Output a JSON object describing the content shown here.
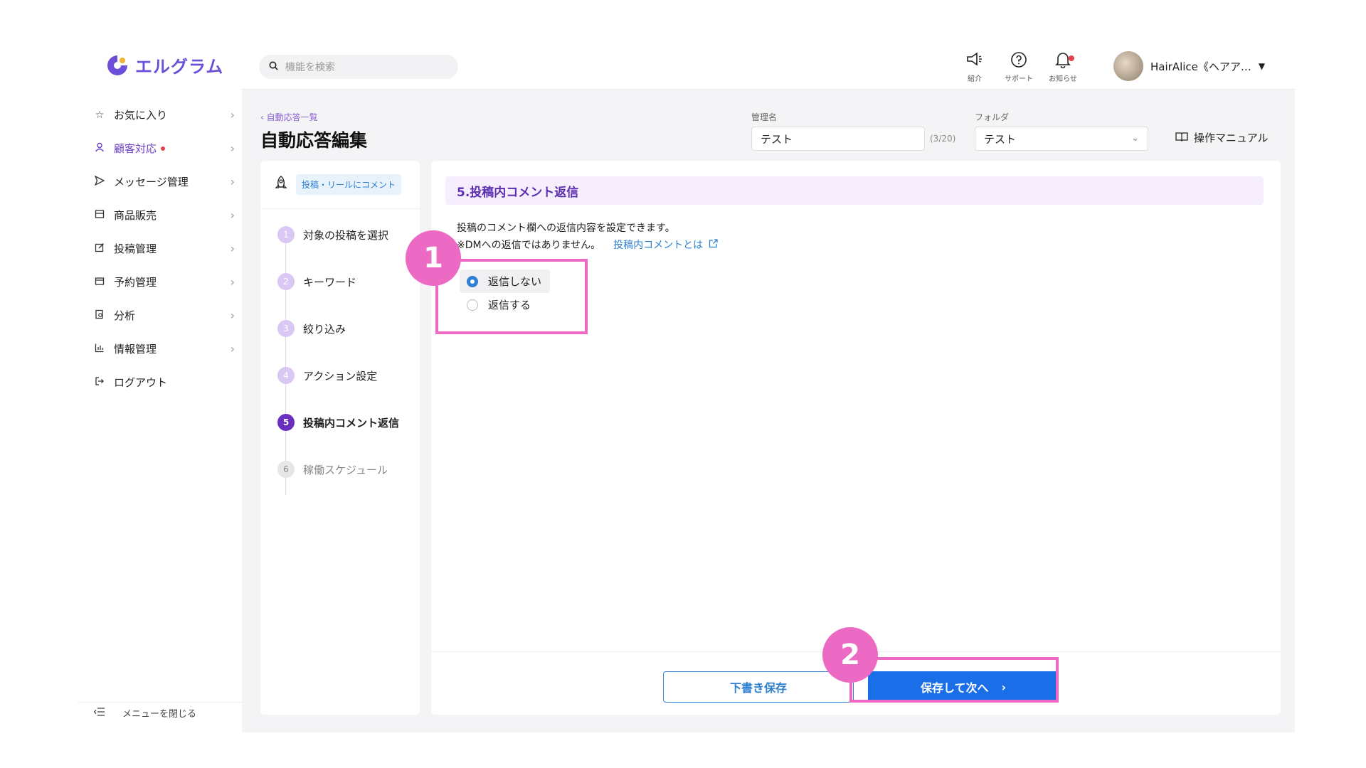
{
  "app": {
    "logo_text": "エルグラム",
    "brand_color": "#6b4fd8"
  },
  "sidebar": {
    "items": [
      {
        "label": "お気に入り",
        "icon": "star-icon"
      },
      {
        "label": "顧客対応",
        "icon": "person-icon"
      },
      {
        "label": "メッセージ管理",
        "icon": "send-icon"
      },
      {
        "label": "商品販売",
        "icon": "store-icon"
      },
      {
        "label": "投稿管理",
        "icon": "edit-icon"
      },
      {
        "label": "予約管理",
        "icon": "calendar-icon"
      },
      {
        "label": "分析",
        "icon": "analysis-icon"
      },
      {
        "label": "情報管理",
        "icon": "chart-icon"
      },
      {
        "label": "ログアウト",
        "icon": "logout-icon"
      }
    ],
    "collapse_label": "メニューを閉じる"
  },
  "topbar": {
    "search_placeholder": "機能を検索",
    "icons": [
      {
        "label": "紹介",
        "icon": "megaphone-icon"
      },
      {
        "label": "サポート",
        "icon": "help-icon"
      },
      {
        "label": "お知らせ",
        "icon": "bell-icon"
      }
    ],
    "user_name": "HairAlice《ヘアア…"
  },
  "page": {
    "breadcrumb": "自動応答一覧",
    "title": "自動応答編集",
    "name_label": "管理名",
    "name_value": "テスト",
    "name_count": "(3/20)",
    "folder_label": "フォルダ",
    "folder_value": "テスト",
    "manual_label": "操作マニュアル"
  },
  "steps": {
    "type_chip": "投稿・リールにコメント",
    "items": [
      {
        "num": "1",
        "label": "対象の投稿を選択"
      },
      {
        "num": "2",
        "label": "キーワード"
      },
      {
        "num": "3",
        "label": "絞り込み"
      },
      {
        "num": "4",
        "label": "アクション設定"
      },
      {
        "num": "5",
        "label": "投稿内コメント返信"
      },
      {
        "num": "6",
        "label": "稼働スケジュール"
      }
    ]
  },
  "content": {
    "section_title": "5.投稿内コメント返信",
    "desc_line1": "投稿のコメント欄への返信内容を設定できます。",
    "desc_line2": "※DMへの返信ではありません。",
    "desc_link": "投稿内コメントとは",
    "options": [
      {
        "label": "返信しない",
        "selected": true
      },
      {
        "label": "返信する",
        "selected": false
      }
    ],
    "draft_button": "下書き保存",
    "next_button": "保存して次へ"
  },
  "annotations": {
    "badge1": "1",
    "badge2": "2",
    "color": "#ec6ac4"
  }
}
